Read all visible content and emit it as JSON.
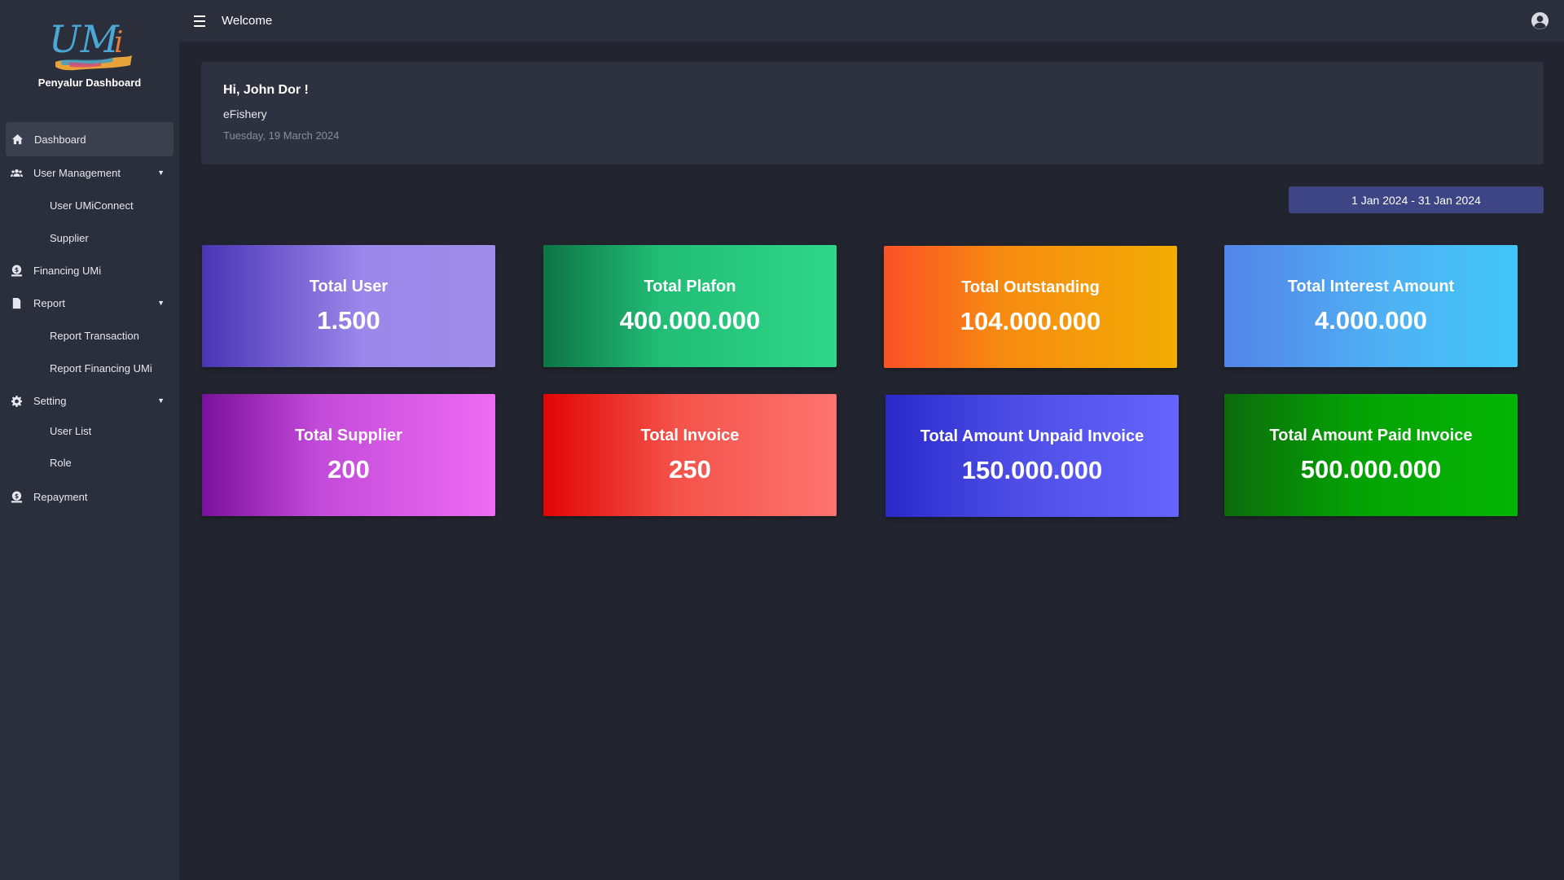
{
  "sidebar": {
    "logo_text": "UMi",
    "title": "Penyalur Dashboard",
    "items": [
      {
        "label": "Dashboard",
        "icon": "home-icon"
      },
      {
        "label": "User Management",
        "icon": "users-icon",
        "children": [
          "User UMiConnect",
          "Supplier"
        ]
      },
      {
        "label": "Financing UMi",
        "icon": "money-icon"
      },
      {
        "label": "Report",
        "icon": "file-icon",
        "children": [
          "Report Transaction",
          "Report Financing UMi"
        ]
      },
      {
        "label": "Setting",
        "icon": "gear-icon",
        "children": [
          "User List",
          "Role"
        ]
      },
      {
        "label": "Repayment",
        "icon": "money-icon"
      }
    ]
  },
  "topbar": {
    "title": "Welcome",
    "menu_icon": "hamburger-icon",
    "user_icon": "user-circle-icon"
  },
  "welcome": {
    "greeting": "Hi, John Dor !",
    "company": "eFishery",
    "date": "Tuesday, 19 March 2024"
  },
  "date_range": "1 Jan 2024 - 31 Jan 2024",
  "stats": [
    {
      "label": "Total User",
      "value": "1.500",
      "color": "#9a88ea"
    },
    {
      "label": "Total Plafon",
      "value": "400.000.000",
      "color": "#22bd76"
    },
    {
      "label": "Total Outstanding",
      "value": "104.000.000",
      "color": "#f78b10"
    },
    {
      "label": "Total Interest Amount",
      "value": "4.000.000",
      "color": "#4fb1f3"
    },
    {
      "label": "Total Supplier",
      "value": "200",
      "color": "#ed6cf2"
    },
    {
      "label": "Total Invoice",
      "value": "250",
      "color": "#f4524a"
    },
    {
      "label": "Total Amount Unpaid Invoice",
      "value": "150.000.000",
      "color": "#4e4ee6"
    },
    {
      "label": "Total Amount Paid Invoice",
      "value": "500.000.000",
      "color": "#04a204"
    }
  ]
}
